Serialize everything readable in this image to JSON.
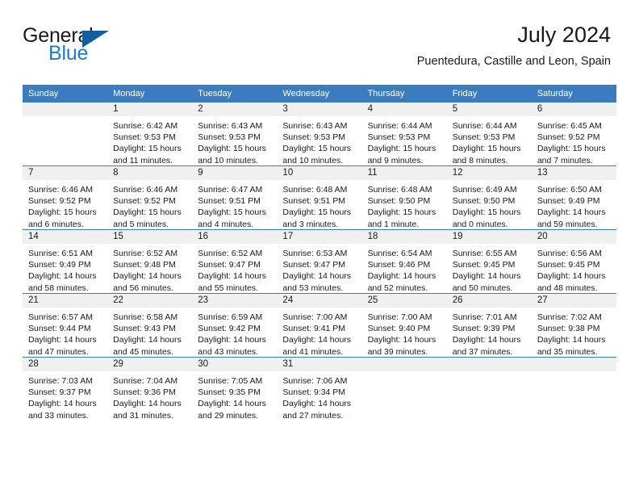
{
  "brand": {
    "word_one": "General",
    "word_two": "Blue",
    "triangle_icon": "triangle-icon",
    "accent_color": "#1f7bc4",
    "triangle_color": "#145da0"
  },
  "header": {
    "title": "July 2024",
    "subtitle": "Puentedura, Castille and Leon, Spain"
  },
  "calendar": {
    "header_bg": "#3a7cbf",
    "daynum_band_bg": "#f0f0f0",
    "weekday_headers": [
      "Sunday",
      "Monday",
      "Tuesday",
      "Wednesday",
      "Thursday",
      "Friday",
      "Saturday"
    ],
    "weeks": [
      [
        {
          "day": "",
          "lines": []
        },
        {
          "day": "1",
          "lines": [
            "Sunrise: 6:42 AM",
            "Sunset: 9:53 PM",
            "Daylight: 15 hours",
            "and 11 minutes."
          ]
        },
        {
          "day": "2",
          "lines": [
            "Sunrise: 6:43 AM",
            "Sunset: 9:53 PM",
            "Daylight: 15 hours",
            "and 10 minutes."
          ]
        },
        {
          "day": "3",
          "lines": [
            "Sunrise: 6:43 AM",
            "Sunset: 9:53 PM",
            "Daylight: 15 hours",
            "and 10 minutes."
          ]
        },
        {
          "day": "4",
          "lines": [
            "Sunrise: 6:44 AM",
            "Sunset: 9:53 PM",
            "Daylight: 15 hours",
            "and 9 minutes."
          ]
        },
        {
          "day": "5",
          "lines": [
            "Sunrise: 6:44 AM",
            "Sunset: 9:53 PM",
            "Daylight: 15 hours",
            "and 8 minutes."
          ]
        },
        {
          "day": "6",
          "lines": [
            "Sunrise: 6:45 AM",
            "Sunset: 9:52 PM",
            "Daylight: 15 hours",
            "and 7 minutes."
          ]
        }
      ],
      [
        {
          "day": "7",
          "lines": [
            "Sunrise: 6:46 AM",
            "Sunset: 9:52 PM",
            "Daylight: 15 hours",
            "and 6 minutes."
          ]
        },
        {
          "day": "8",
          "lines": [
            "Sunrise: 6:46 AM",
            "Sunset: 9:52 PM",
            "Daylight: 15 hours",
            "and 5 minutes."
          ]
        },
        {
          "day": "9",
          "lines": [
            "Sunrise: 6:47 AM",
            "Sunset: 9:51 PM",
            "Daylight: 15 hours",
            "and 4 minutes."
          ]
        },
        {
          "day": "10",
          "lines": [
            "Sunrise: 6:48 AM",
            "Sunset: 9:51 PM",
            "Daylight: 15 hours",
            "and 3 minutes."
          ]
        },
        {
          "day": "11",
          "lines": [
            "Sunrise: 6:48 AM",
            "Sunset: 9:50 PM",
            "Daylight: 15 hours",
            "and 1 minute."
          ]
        },
        {
          "day": "12",
          "lines": [
            "Sunrise: 6:49 AM",
            "Sunset: 9:50 PM",
            "Daylight: 15 hours",
            "and 0 minutes."
          ]
        },
        {
          "day": "13",
          "lines": [
            "Sunrise: 6:50 AM",
            "Sunset: 9:49 PM",
            "Daylight: 14 hours",
            "and 59 minutes."
          ]
        }
      ],
      [
        {
          "day": "14",
          "lines": [
            "Sunrise: 6:51 AM",
            "Sunset: 9:49 PM",
            "Daylight: 14 hours",
            "and 58 minutes."
          ]
        },
        {
          "day": "15",
          "lines": [
            "Sunrise: 6:52 AM",
            "Sunset: 9:48 PM",
            "Daylight: 14 hours",
            "and 56 minutes."
          ]
        },
        {
          "day": "16",
          "lines": [
            "Sunrise: 6:52 AM",
            "Sunset: 9:47 PM",
            "Daylight: 14 hours",
            "and 55 minutes."
          ]
        },
        {
          "day": "17",
          "lines": [
            "Sunrise: 6:53 AM",
            "Sunset: 9:47 PM",
            "Daylight: 14 hours",
            "and 53 minutes."
          ]
        },
        {
          "day": "18",
          "lines": [
            "Sunrise: 6:54 AM",
            "Sunset: 9:46 PM",
            "Daylight: 14 hours",
            "and 52 minutes."
          ]
        },
        {
          "day": "19",
          "lines": [
            "Sunrise: 6:55 AM",
            "Sunset: 9:45 PM",
            "Daylight: 14 hours",
            "and 50 minutes."
          ]
        },
        {
          "day": "20",
          "lines": [
            "Sunrise: 6:56 AM",
            "Sunset: 9:45 PM",
            "Daylight: 14 hours",
            "and 48 minutes."
          ]
        }
      ],
      [
        {
          "day": "21",
          "lines": [
            "Sunrise: 6:57 AM",
            "Sunset: 9:44 PM",
            "Daylight: 14 hours",
            "and 47 minutes."
          ]
        },
        {
          "day": "22",
          "lines": [
            "Sunrise: 6:58 AM",
            "Sunset: 9:43 PM",
            "Daylight: 14 hours",
            "and 45 minutes."
          ]
        },
        {
          "day": "23",
          "lines": [
            "Sunrise: 6:59 AM",
            "Sunset: 9:42 PM",
            "Daylight: 14 hours",
            "and 43 minutes."
          ]
        },
        {
          "day": "24",
          "lines": [
            "Sunrise: 7:00 AM",
            "Sunset: 9:41 PM",
            "Daylight: 14 hours",
            "and 41 minutes."
          ]
        },
        {
          "day": "25",
          "lines": [
            "Sunrise: 7:00 AM",
            "Sunset: 9:40 PM",
            "Daylight: 14 hours",
            "and 39 minutes."
          ]
        },
        {
          "day": "26",
          "lines": [
            "Sunrise: 7:01 AM",
            "Sunset: 9:39 PM",
            "Daylight: 14 hours",
            "and 37 minutes."
          ]
        },
        {
          "day": "27",
          "lines": [
            "Sunrise: 7:02 AM",
            "Sunset: 9:38 PM",
            "Daylight: 14 hours",
            "and 35 minutes."
          ]
        }
      ],
      [
        {
          "day": "28",
          "lines": [
            "Sunrise: 7:03 AM",
            "Sunset: 9:37 PM",
            "Daylight: 14 hours",
            "and 33 minutes."
          ]
        },
        {
          "day": "29",
          "lines": [
            "Sunrise: 7:04 AM",
            "Sunset: 9:36 PM",
            "Daylight: 14 hours",
            "and 31 minutes."
          ]
        },
        {
          "day": "30",
          "lines": [
            "Sunrise: 7:05 AM",
            "Sunset: 9:35 PM",
            "Daylight: 14 hours",
            "and 29 minutes."
          ]
        },
        {
          "day": "31",
          "lines": [
            "Sunrise: 7:06 AM",
            "Sunset: 9:34 PM",
            "Daylight: 14 hours",
            "and 27 minutes."
          ]
        },
        {
          "day": "",
          "lines": []
        },
        {
          "day": "",
          "lines": []
        },
        {
          "day": "",
          "lines": []
        }
      ]
    ]
  }
}
